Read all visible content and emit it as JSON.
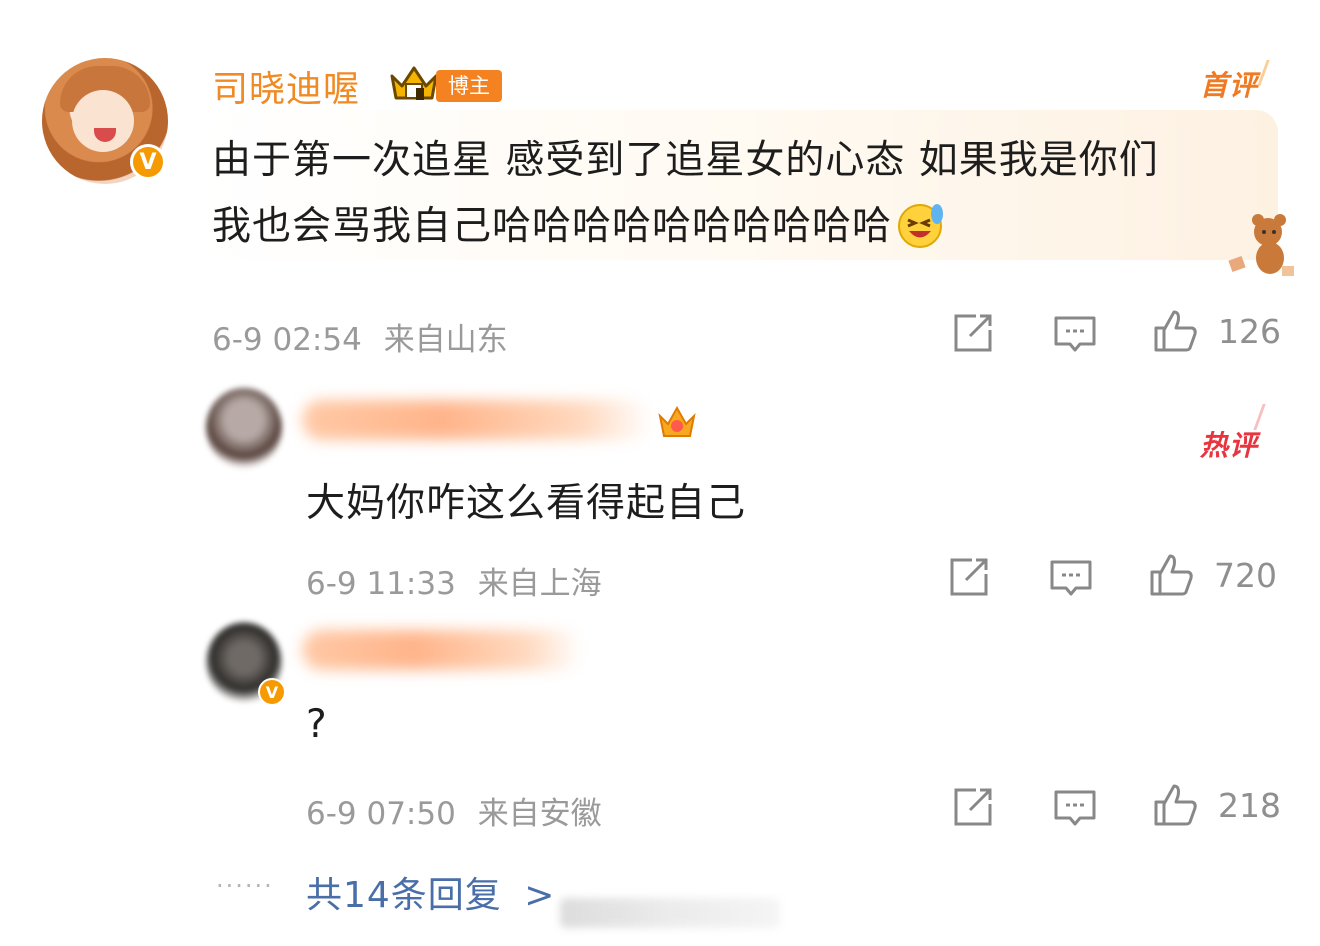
{
  "comment": {
    "username": "司晓迪喔",
    "rank_badge": "博主",
    "tag": "首评",
    "text_line1": "由于第一次追星 感受到了追星女的心态 如果我是你们",
    "text_line2": "我也会骂我自己哈哈哈哈哈哈哈哈哈哈",
    "verified_mark": "V",
    "timestamp": "6-9 02:54",
    "location": "来自山东",
    "likes": "126"
  },
  "replies": [
    {
      "tag": "热评",
      "text": "大妈你咋这么看得起自己",
      "timestamp": "6-9 11:33",
      "location": "来自上海",
      "likes": "720"
    },
    {
      "text": "?",
      "timestamp": "6-9 07:50",
      "location": "来自安徽",
      "likes": "218"
    }
  ],
  "more": {
    "ellipsis": "······",
    "label": "共14条回复",
    "arrow": ">"
  },
  "icons": {
    "share": "share-icon",
    "comment": "comment-icon",
    "like": "thumbs-up-icon"
  },
  "colors": {
    "username": "#f08a24",
    "hot": "#e8343f",
    "link": "#4a6ea8",
    "meta": "#9a9a9a"
  }
}
